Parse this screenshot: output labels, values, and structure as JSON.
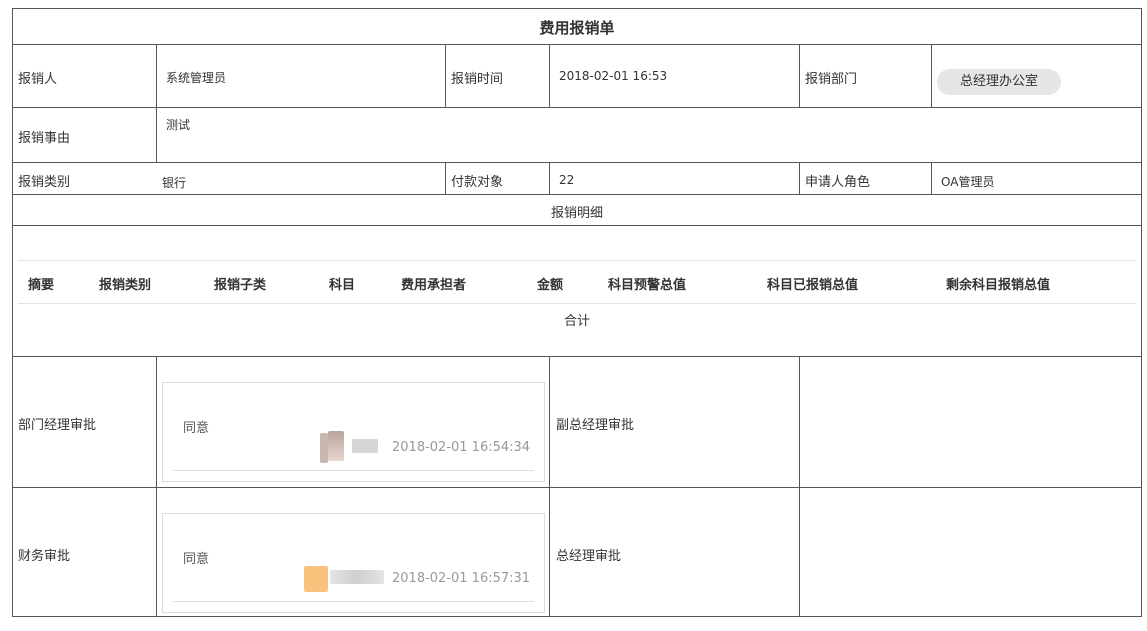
{
  "form": {
    "title": "费用报销单",
    "applicant_label": "报销人",
    "applicant_value": "系统管理员",
    "time_label": "报销时间",
    "time_value": "2018-02-01 16:53",
    "dept_label": "报销部门",
    "dept_value": "总经理办公室",
    "reason_label": "报销事由",
    "reason_value": "测试",
    "category_label": "报销类别",
    "category_value": "银行",
    "payee_label": "付款对象",
    "payee_value": "22",
    "role_label": "申请人角色",
    "role_value": "OA管理员",
    "detail_label": "报销明细"
  },
  "detail_table": {
    "headers": [
      "摘要",
      "报销类别",
      "报销子类",
      "科目",
      "费用承担者",
      "金额",
      "科目预警总值",
      "科目已报销总值",
      "剩余科目报销总值"
    ],
    "total_label": "合计"
  },
  "approvals": {
    "dept_manager_label": "部门经理审批",
    "dept_manager_comment": "同意",
    "dept_manager_time": "2018-02-01 16:54:34",
    "deputy_gm_label": "副总经理审批",
    "finance_label": "财务审批",
    "finance_comment": "同意",
    "finance_time": "2018-02-01 16:57:31",
    "gm_label": "总经理审批"
  }
}
